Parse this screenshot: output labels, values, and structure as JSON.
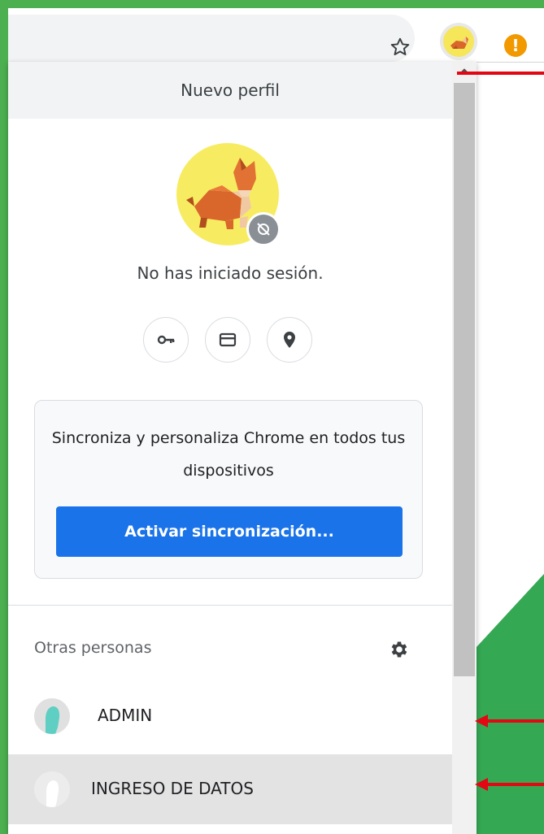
{
  "popup": {
    "header_title": "Nuevo perfil",
    "status": "No has iniciado sesión.",
    "quick_actions": [
      {
        "icon": "key-icon",
        "label": "passwords"
      },
      {
        "icon": "credit-card-icon",
        "label": "payment-methods"
      },
      {
        "icon": "location-pin-icon",
        "label": "addresses"
      }
    ],
    "sync_card": {
      "text": "Sincroniza y personaliza Chrome en todos tus dispositivos",
      "button_label": "Activar sincronización..."
    },
    "others_section": {
      "label": "Otras personas",
      "profiles": [
        {
          "name": "ADMIN",
          "avatar_color": "#5fcfc3"
        },
        {
          "name": "INGRESO DE DATOS",
          "avatar_color": "#ffffff"
        }
      ]
    }
  },
  "colors": {
    "frame_green": "#4caf50",
    "page_green": "#34a853",
    "sync_blue": "#1a73e8",
    "warning_orange": "#f29900",
    "annotation_red": "#e30613",
    "hover_row": "#e3e3e3"
  }
}
